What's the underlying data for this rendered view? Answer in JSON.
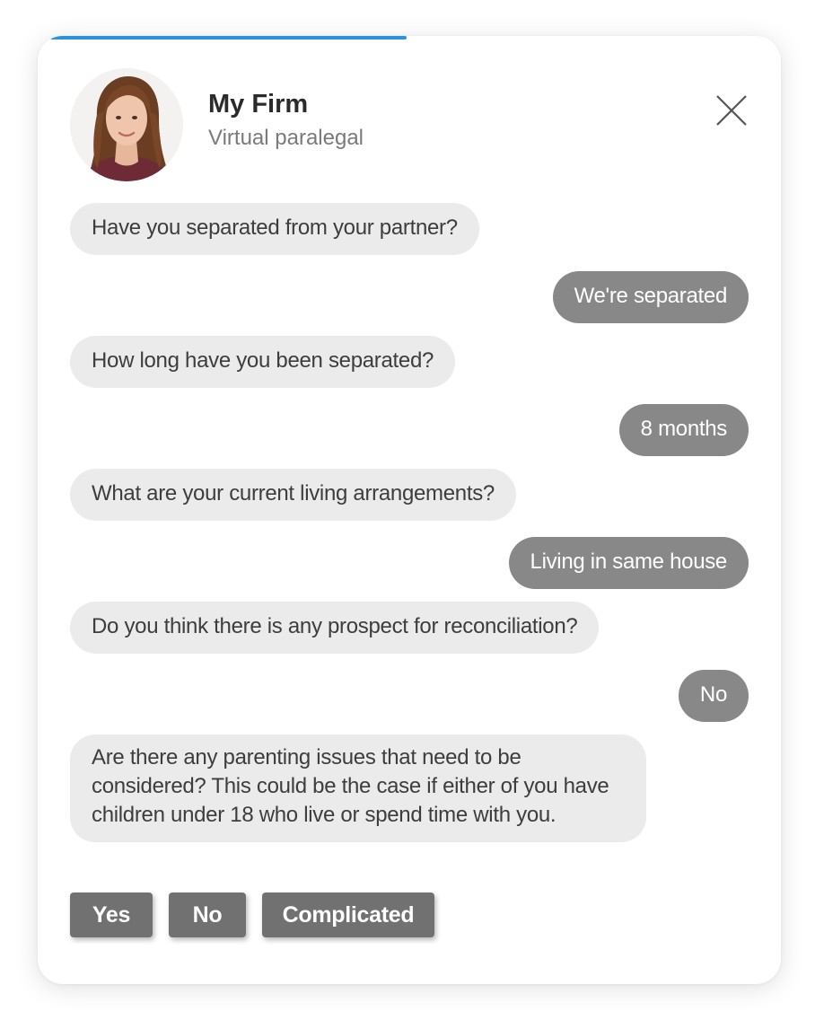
{
  "header": {
    "firm_name": "My Firm",
    "role": "Virtual paralegal",
    "avatar": "paralegal-portrait",
    "close_icon": "close-icon"
  },
  "progress": {
    "fraction": 0.48,
    "color": "#2a92e0"
  },
  "messages": [
    {
      "from": "bot",
      "text": "Have you separated from your partner?"
    },
    {
      "from": "user",
      "text": "We're separated"
    },
    {
      "from": "bot",
      "text": "How long have you been separated?"
    },
    {
      "from": "user",
      "text": "8 months"
    },
    {
      "from": "bot",
      "text": "What are your current living arrangements?"
    },
    {
      "from": "user",
      "text": "Living in same house"
    },
    {
      "from": "bot",
      "text": "Do you think there is any prospect for reconciliation?"
    },
    {
      "from": "user",
      "text": "No"
    },
    {
      "from": "bot",
      "text": "Are there any parenting issues that need to be considered? This could be the case if either of you have children under 18 who live or spend time with you."
    }
  ],
  "choices": [
    {
      "label": "Yes"
    },
    {
      "label": "No"
    },
    {
      "label": "Complicated"
    }
  ],
  "colors": {
    "bot_bubble": "#ebebeb",
    "user_bubble": "#888888",
    "choice_button": "#717171"
  }
}
